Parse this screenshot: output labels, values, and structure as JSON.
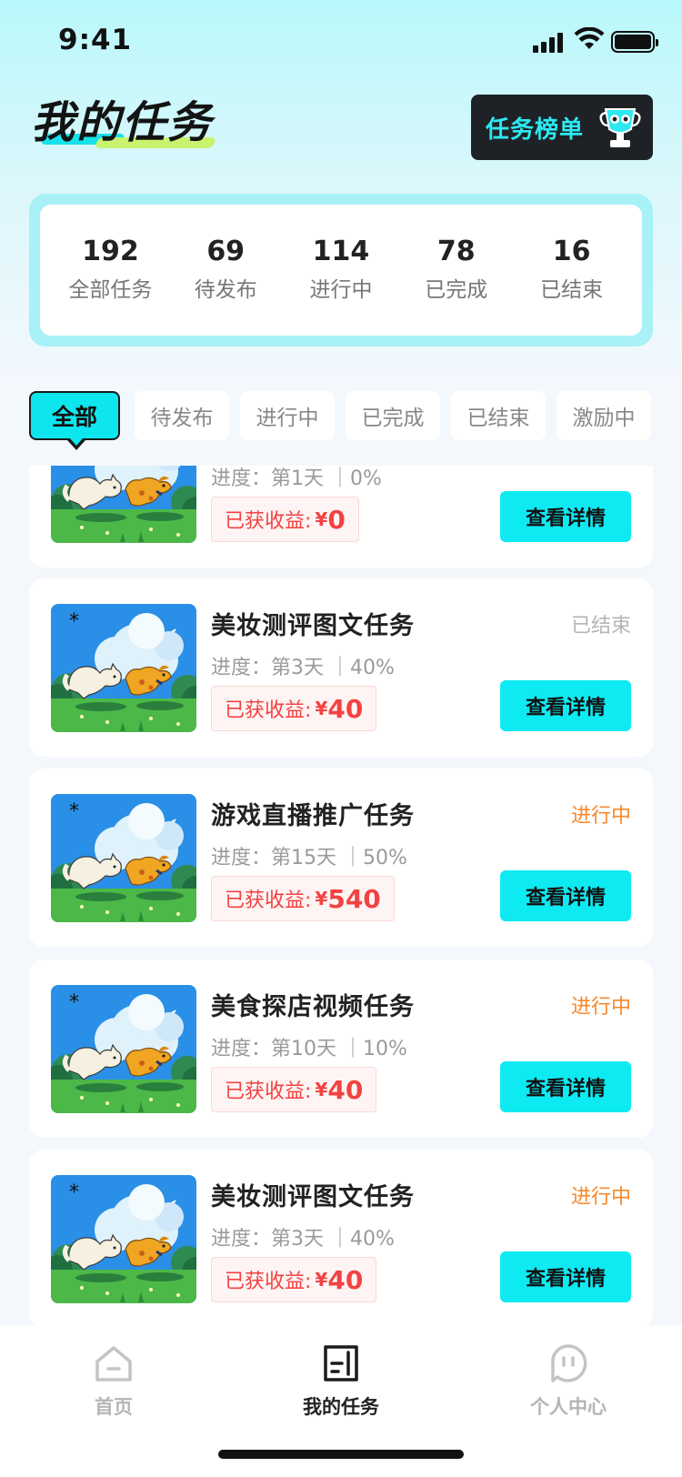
{
  "status_bar": {
    "time": "9:41"
  },
  "header": {
    "title": "我的任务",
    "rank_button": "任务榜单"
  },
  "stats": [
    {
      "num": "192",
      "label": "全部任务"
    },
    {
      "num": "69",
      "label": "待发布"
    },
    {
      "num": "114",
      "label": "进行中"
    },
    {
      "num": "78",
      "label": "已完成"
    },
    {
      "num": "16",
      "label": "已结束"
    }
  ],
  "tabs": [
    "全部",
    "待发布",
    "进行中",
    "已完成",
    "已结束",
    "激励中"
  ],
  "active_tab": "全部",
  "tasks": [
    {
      "name": "",
      "status": "",
      "progress_label": "进度：",
      "day": "第1天",
      "percent": "0%",
      "earn_label": "已获收益:",
      "yen": "¥",
      "earn": "0",
      "button": "查看详情"
    },
    {
      "name": "美妆测评图文任务",
      "status": "已结束",
      "progress_label": "进度：",
      "day": "第3天",
      "percent": "40%",
      "earn_label": "已获收益:",
      "yen": "¥",
      "earn": "40",
      "button": "查看详情"
    },
    {
      "name": "游戏直播推广任务",
      "status": "进行中",
      "progress_label": "进度：",
      "day": "第15天",
      "percent": "50%",
      "earn_label": "已获收益:",
      "yen": "¥",
      "earn": "540",
      "button": "查看详情"
    },
    {
      "name": "美食探店视频任务",
      "status": "进行中",
      "progress_label": "进度：",
      "day": "第10天",
      "percent": "10%",
      "earn_label": "已获收益:",
      "yen": "¥",
      "earn": "40",
      "button": "查看详情"
    },
    {
      "name": "美妆测评图文任务",
      "status": "进行中",
      "progress_label": "进度：",
      "day": "第3天",
      "percent": "40%",
      "earn_label": "已获收益:",
      "yen": "¥",
      "earn": "40",
      "button": "查看详情"
    }
  ],
  "tabbar": [
    {
      "label": "首页",
      "icon": "home-icon"
    },
    {
      "label": "我的任务",
      "icon": "task-list-icon"
    },
    {
      "label": "个人中心",
      "icon": "profile-icon"
    }
  ],
  "colors": {
    "accent": "#0deaf2",
    "earn": "#f24242",
    "in_progress": "#f6892b",
    "ended": "#b5b5b5",
    "dark": "#1e2226"
  }
}
